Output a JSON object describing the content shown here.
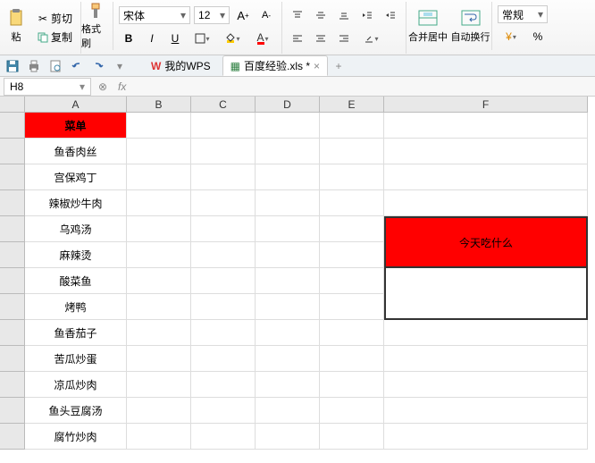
{
  "ribbon": {
    "cut": "剪切",
    "copy": "复制",
    "format_painter": "格式刷",
    "paste": "粘",
    "font_name": "宋体",
    "font_size": "12",
    "merge_center": "合并居中",
    "auto_wrap": "自动换行",
    "general": "常规"
  },
  "tabs": {
    "wps": "我的WPS",
    "doc": "百度经验.xls *"
  },
  "formula": {
    "cell_ref": "H8",
    "fx": "fx"
  },
  "columns": [
    "A",
    "B",
    "C",
    "D",
    "E",
    "F"
  ],
  "menu_header": "菜单",
  "menu": [
    "鱼香肉丝",
    "宫保鸡丁",
    "辣椒炒牛肉",
    "乌鸡汤",
    "麻辣烫",
    "酸菜鱼",
    "烤鸭",
    "鱼香茄子",
    "苦瓜炒蛋",
    "凉瓜炒肉",
    "鱼头豆腐汤",
    "腐竹炒肉"
  ],
  "question": "今天吃什么",
  "chart_data": {
    "type": "table",
    "title": "菜单",
    "columns": [
      "A"
    ],
    "rows": [
      [
        "鱼香肉丝"
      ],
      [
        "宫保鸡丁"
      ],
      [
        "辣椒炒牛肉"
      ],
      [
        "乌鸡汤"
      ],
      [
        "麻辣烫"
      ],
      [
        "酸菜鱼"
      ],
      [
        "烤鸭"
      ],
      [
        "鱼香茄子"
      ],
      [
        "苦瓜炒蛋"
      ],
      [
        "凉瓜炒肉"
      ],
      [
        "鱼头豆腐汤"
      ],
      [
        "腐竹炒肉"
      ]
    ],
    "annotations": [
      {
        "cell": "F5:F6",
        "text": "今天吃什么",
        "fill": "#ff0000"
      }
    ]
  }
}
